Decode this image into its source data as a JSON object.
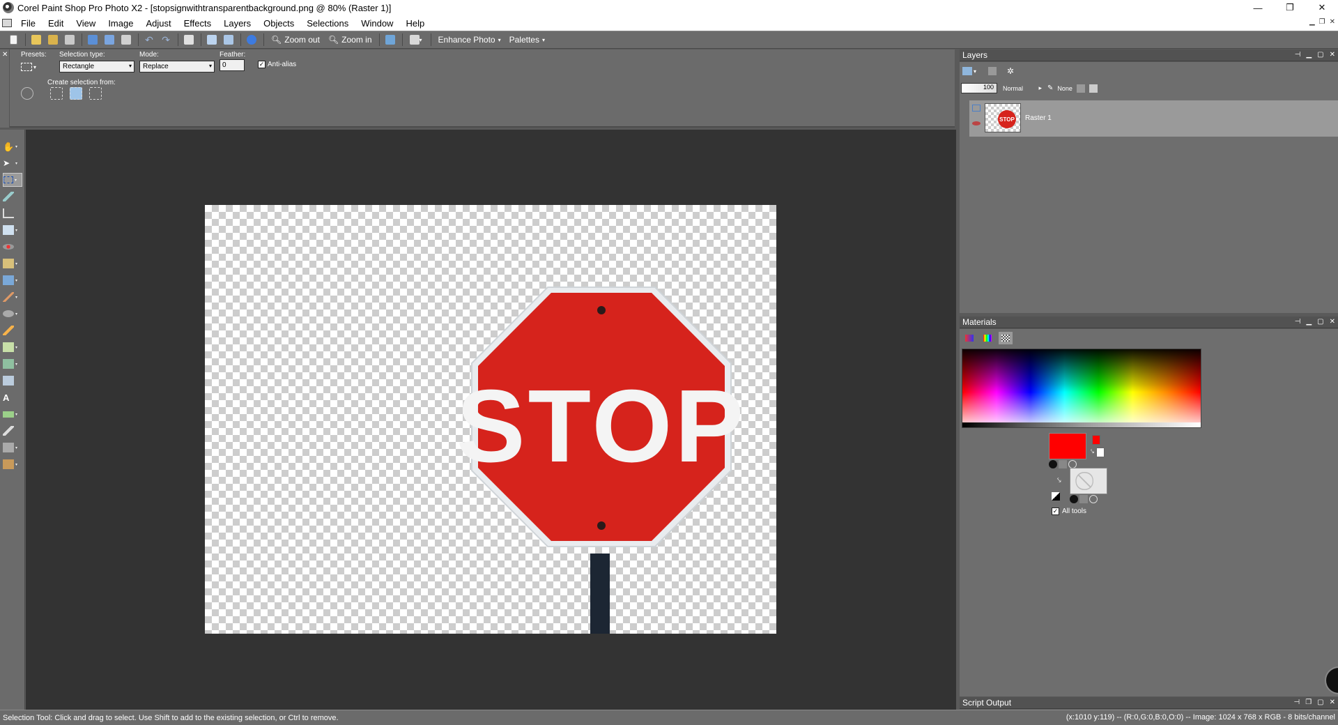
{
  "window": {
    "title": "Corel Paint Shop Pro Photo X2 - [stopsignwithtransparentbackground.png @  80% (Raster 1)]",
    "controls": [
      "—",
      "❐",
      "✕"
    ]
  },
  "menu": [
    "File",
    "Edit",
    "View",
    "Image",
    "Adjust",
    "Effects",
    "Layers",
    "Objects",
    "Selections",
    "Window",
    "Help"
  ],
  "toolbar": {
    "zoom_out": "Zoom out",
    "zoom_in": "Zoom in",
    "enhance_photo": "Enhance Photo",
    "palettes": "Palettes"
  },
  "tool_options": {
    "presets_label": "Presets:",
    "selection_type_label": "Selection type:",
    "selection_type_value": "Rectangle",
    "mode_label": "Mode:",
    "mode_value": "Replace",
    "feather_label": "Feather:",
    "feather_value": "0",
    "antialias_label": "Anti-alias",
    "antialias_checked": true,
    "create_selection_label": "Create selection from:"
  },
  "layers": {
    "title": "Layers",
    "opacity": "100",
    "blend_mode": "Normal",
    "mask": "None",
    "layer_name": "Raster 1",
    "thumb_text": "STOP"
  },
  "materials": {
    "title": "Materials",
    "foreground_color": "#ff0000",
    "background_color": "#ffffff",
    "all_tools_label": "All tools",
    "all_tools_checked": true
  },
  "script_output": {
    "title": "Script Output"
  },
  "canvas": {
    "sign_text": "STOP",
    "sign_color": "#d6231c"
  },
  "status": {
    "hint": "Selection Tool: Click and drag to select. Use Shift to add to the existing selection, or Ctrl to remove.",
    "info": "(x:1010 y:119) -- (R:0,G:0,B:0,O:0) -- Image:  1024 x 768 x RGB - 8 bits/channel"
  }
}
